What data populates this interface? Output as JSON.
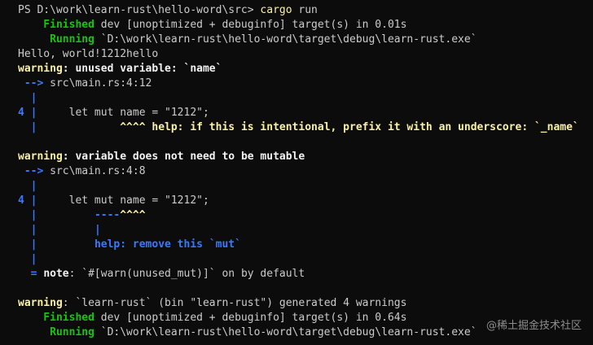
{
  "terminal": {
    "lines": [
      {
        "segments": [
          {
            "text": "PS D:\\work\\learn-rust\\hello-word\\src> ",
            "style": "plain"
          },
          {
            "text": "cargo",
            "style": "cmd-name"
          },
          {
            "text": " run",
            "style": "plain"
          }
        ]
      },
      {
        "segments": [
          {
            "text": "    Finished",
            "style": "green"
          },
          {
            "text": " dev [unoptimized + debuginfo] target(s) in 0.01s",
            "style": "plain"
          }
        ]
      },
      {
        "segments": [
          {
            "text": "     Running",
            "style": "green"
          },
          {
            "text": " `D:\\work\\learn-rust\\hello-word\\target\\debug\\learn-rust.exe`",
            "style": "plain"
          }
        ]
      },
      {
        "segments": [
          {
            "text": "Hello, world!1212hello",
            "style": "plain"
          }
        ]
      },
      {
        "segments": [
          {
            "text": "warning",
            "style": "yellow"
          },
          {
            "text": ": unused variable: `name`",
            "style": "white"
          }
        ]
      },
      {
        "segments": [
          {
            "text": " --> ",
            "style": "blue"
          },
          {
            "text": "src\\main.rs:4:12",
            "style": "plain"
          }
        ]
      },
      {
        "segments": [
          {
            "text": "  |",
            "style": "blue"
          }
        ]
      },
      {
        "segments": [
          {
            "text": "4 |",
            "style": "blue"
          },
          {
            "text": "     let mut name = \"1212\";",
            "style": "plain"
          }
        ]
      },
      {
        "segments": [
          {
            "text": "  |",
            "style": "blue"
          },
          {
            "text": "             ",
            "style": "plain"
          },
          {
            "text": "^^^^ help: if this is intentional, prefix it with an underscore: `_name`",
            "style": "yellow"
          }
        ]
      },
      {
        "segments": []
      },
      {
        "segments": [
          {
            "text": "warning",
            "style": "yellow"
          },
          {
            "text": ": variable does not need to be mutable",
            "style": "white"
          }
        ]
      },
      {
        "segments": [
          {
            "text": " --> ",
            "style": "blue"
          },
          {
            "text": "src\\main.rs:4:8",
            "style": "plain"
          }
        ]
      },
      {
        "segments": [
          {
            "text": "  |",
            "style": "blue"
          }
        ]
      },
      {
        "segments": [
          {
            "text": "4 |",
            "style": "blue"
          },
          {
            "text": "     let mut name = \"1212\";",
            "style": "plain"
          }
        ]
      },
      {
        "segments": [
          {
            "text": "  |",
            "style": "blue"
          },
          {
            "text": "         ",
            "style": "plain"
          },
          {
            "text": "----",
            "style": "blue"
          },
          {
            "text": "^^^^",
            "style": "yellow"
          }
        ]
      },
      {
        "segments": [
          {
            "text": "  |",
            "style": "blue"
          },
          {
            "text": "         ",
            "style": "plain"
          },
          {
            "text": "|",
            "style": "blue"
          }
        ]
      },
      {
        "segments": [
          {
            "text": "  |",
            "style": "blue"
          },
          {
            "text": "         ",
            "style": "plain"
          },
          {
            "text": "help: remove this `mut`",
            "style": "blue"
          }
        ]
      },
      {
        "segments": [
          {
            "text": "  |",
            "style": "blue"
          }
        ]
      },
      {
        "segments": [
          {
            "text": "  = ",
            "style": "blue"
          },
          {
            "text": "note",
            "style": "white"
          },
          {
            "text": ": `#[warn(unused_mut)]` on by default",
            "style": "plain"
          }
        ]
      },
      {
        "segments": []
      },
      {
        "segments": [
          {
            "text": "warning",
            "style": "yellow"
          },
          {
            "text": ": `learn-rust` (bin \"learn-rust\") generated 4 warnings",
            "style": "plain"
          }
        ]
      },
      {
        "segments": [
          {
            "text": "    Finished",
            "style": "green"
          },
          {
            "text": " dev [unoptimized + debuginfo] target(s) in 0.64s",
            "style": "plain"
          }
        ]
      },
      {
        "segments": [
          {
            "text": "     Running",
            "style": "green"
          },
          {
            "text": " `D:\\work\\learn-rust\\hello-word\\target\\debug\\learn-rust.exe`",
            "style": "plain"
          }
        ]
      }
    ]
  },
  "watermark": {
    "text": "@稀土掘金技术社区"
  }
}
